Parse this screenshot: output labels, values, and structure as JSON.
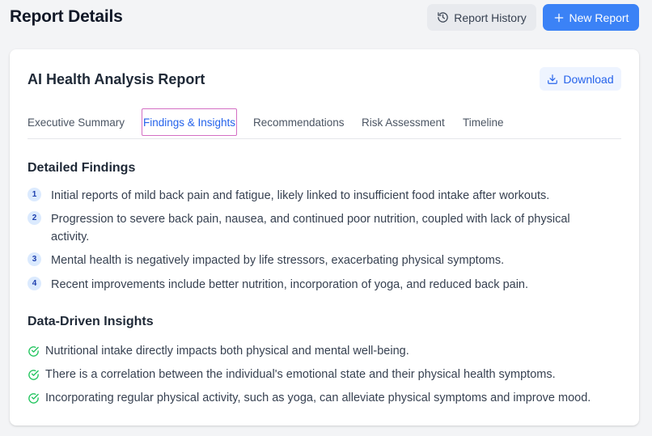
{
  "header": {
    "title": "Report Details",
    "history_button": {
      "label": "Report History",
      "icon": "history-icon"
    },
    "new_button": {
      "label": "New Report",
      "icon": "plus-icon"
    }
  },
  "report": {
    "title": "AI Health Analysis Report",
    "download_button": {
      "label": "Download",
      "icon": "download-icon"
    },
    "tabs": [
      {
        "label": "Executive Summary",
        "active": false
      },
      {
        "label": "Findings & Insights",
        "active": true
      },
      {
        "label": "Recommendations",
        "active": false
      },
      {
        "label": "Risk Assessment",
        "active": false
      },
      {
        "label": "Timeline",
        "active": false
      }
    ],
    "findings": {
      "title": "Detailed Findings",
      "items": [
        {
          "number": "1",
          "text": "Initial reports of mild back pain and fatigue, likely linked to insufficient food intake after workouts."
        },
        {
          "number": "2",
          "text": "Progression to severe back pain, nausea, and continued poor nutrition, coupled with lack of physical activity."
        },
        {
          "number": "3",
          "text": "Mental health is negatively impacted by life stressors, exacerbating physical symptoms."
        },
        {
          "number": "4",
          "text": "Recent improvements include better nutrition, incorporation of yoga, and reduced back pain."
        }
      ]
    },
    "insights": {
      "title": "Data-Driven Insights",
      "items": [
        {
          "text": "Nutritional intake directly impacts both physical and mental well-being."
        },
        {
          "text": "There is a correlation between the individual's emotional state and their physical health symptoms."
        },
        {
          "text": "Incorporating regular physical activity, such as yoga, can alleviate physical symptoms and improve mood."
        }
      ]
    }
  },
  "colors": {
    "accent": "#3b82f6",
    "active_tab": "#2563eb",
    "check": "#22c55e",
    "badge_bg": "#dbeafe"
  }
}
